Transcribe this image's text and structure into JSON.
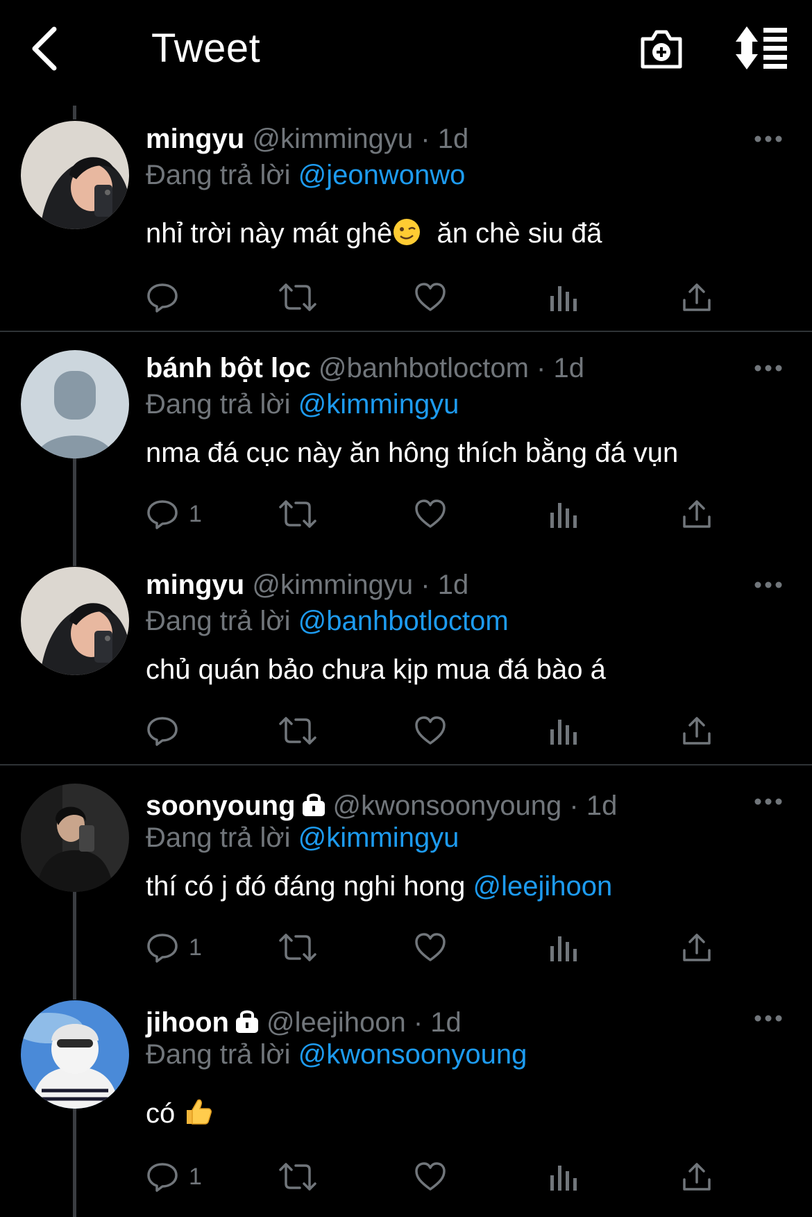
{
  "header": {
    "title": "Tweet",
    "back_icon": "chevron-left-icon",
    "camera_icon": "camera-add-icon",
    "sort_icon": "sort-list-icon"
  },
  "colors": {
    "background": "#000000",
    "text": "#e7e9ea",
    "muted": "#71767b",
    "accent": "#1d9bf0",
    "divider": "#2f3336"
  },
  "tweets": [
    {
      "name": "mingyu",
      "handle": "@kimmingyu",
      "sep": "·",
      "time": "1d",
      "reply_prefix": "Đang trả lời",
      "reply_to": "@jeonwonwo",
      "text_before": "nhỉ trời này mát ghê",
      "emoji": "winking-face",
      "text_after": "  ăn chè siu đã",
      "avatar": "photo-mingyu",
      "replies": "",
      "locked": false
    },
    {
      "name": "bánh bột lọc",
      "handle": "@banhbotloctom",
      "sep": "·",
      "time": "1d",
      "reply_prefix": "Đang trả lời",
      "reply_to": "@kimmingyu",
      "text": "nma đá cục này ăn hông thích bằng đá vụn",
      "avatar": "default-avatar",
      "replies": "1",
      "locked": false
    },
    {
      "name": "mingyu",
      "handle": "@kimmingyu",
      "sep": "·",
      "time": "1d",
      "reply_prefix": "Đang trả lời",
      "reply_to": "@banhbotloctom",
      "text": "chủ quán bảo chưa kịp mua đá bào á",
      "avatar": "photo-mingyu",
      "replies": "",
      "locked": false
    },
    {
      "name": "soonyoung",
      "handle": "@kwonsoonyoung",
      "sep": "·",
      "time": "1d",
      "reply_prefix": "Đang trả lời",
      "reply_to": "@kimmingyu",
      "text": "thí có j đó đáng nghi hong ",
      "text_mention": "@leejihoon",
      "avatar": "photo-soonyoung",
      "replies": "1",
      "locked": true
    },
    {
      "name": "jihoon",
      "handle": "@leejihoon",
      "sep": "·",
      "time": "1d",
      "reply_prefix": "Đang trả lời",
      "reply_to": "@kwonsoonyoung",
      "text": "có ",
      "emoji": "thumbs-up",
      "avatar": "photo-jihoon",
      "replies": "1",
      "locked": true
    }
  ]
}
